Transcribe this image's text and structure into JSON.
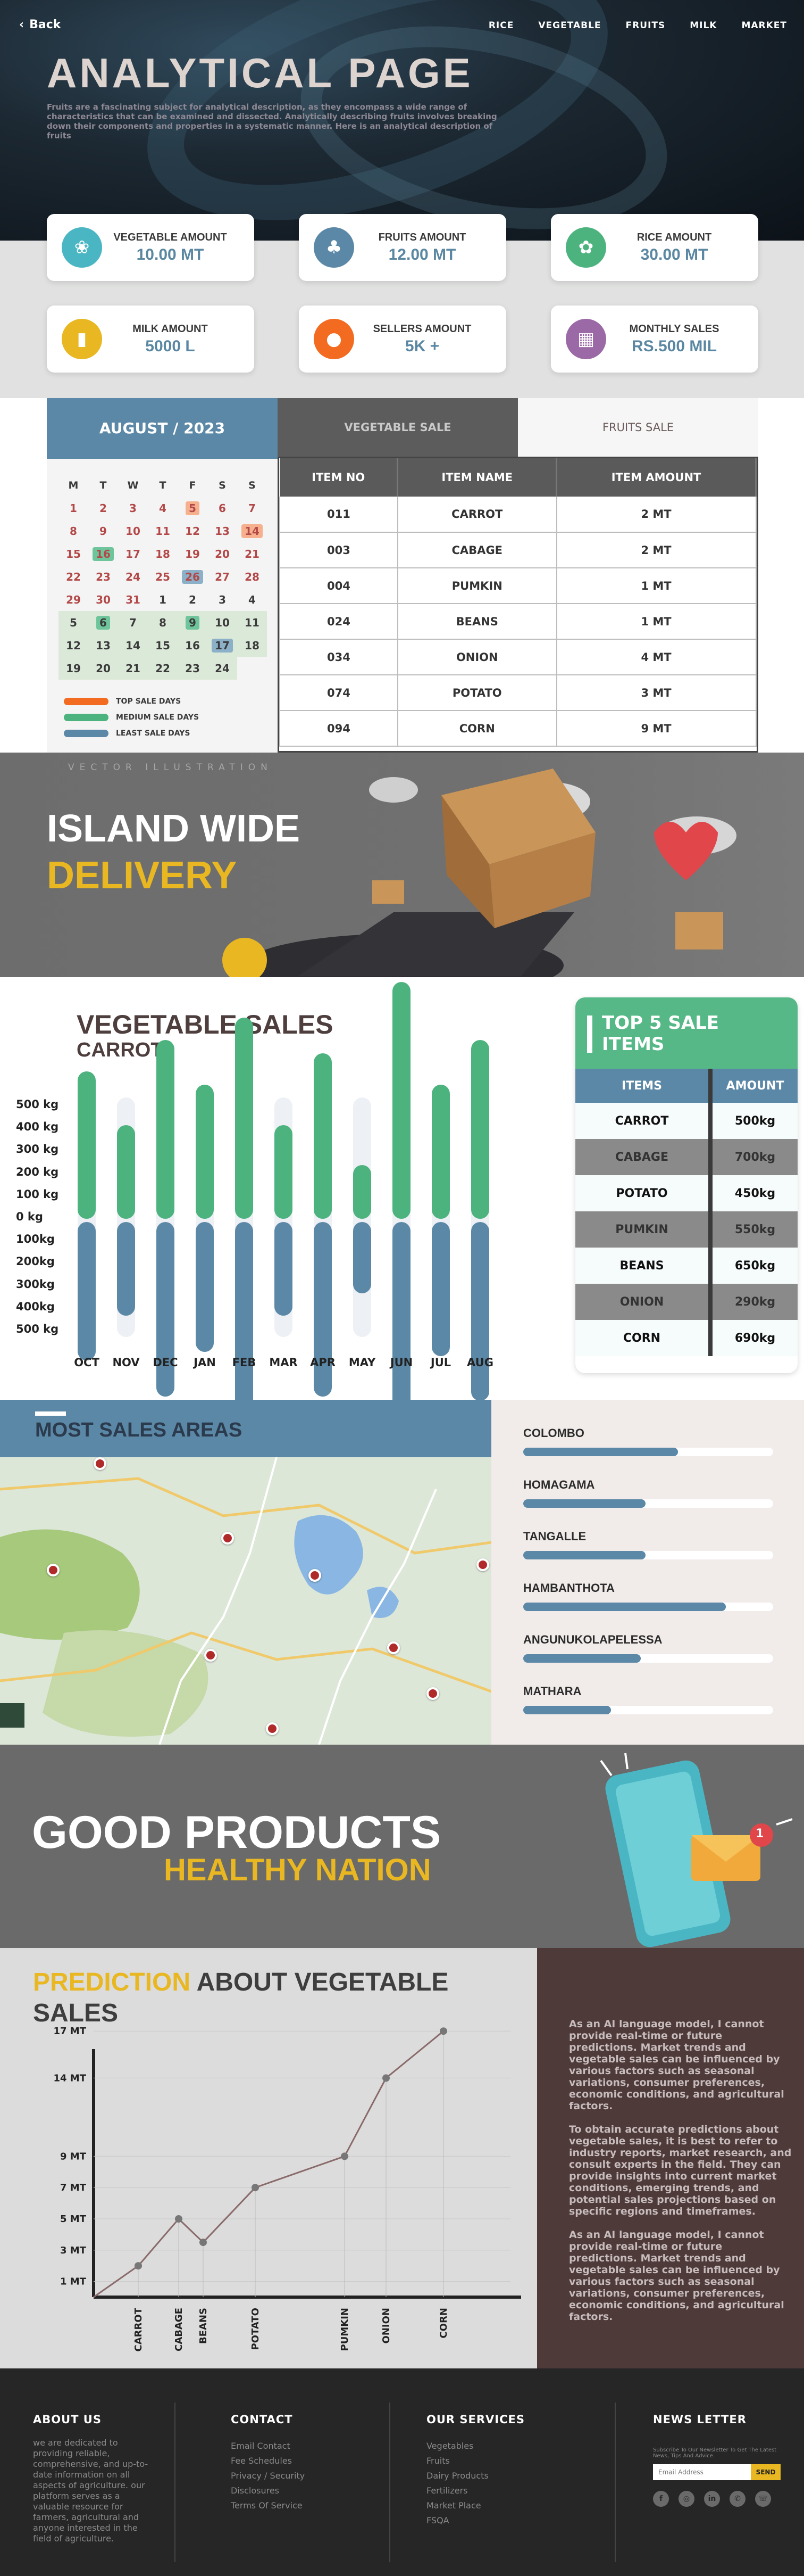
{
  "nav": {
    "back_label": "Back",
    "links": [
      "RICE",
      "VEGETABLE",
      "FRUITS",
      "MILK",
      "MARKET"
    ]
  },
  "hero": {
    "title": "ANALYTICAL PAGE",
    "description": "Fruits are a fascinating subject for analytical description, as they encompass a wide range of characteristics that can be examined and dissected. Analytically describing fruits involves breaking down their components and properties in a systematic manner. Here is an analytical description of fruits"
  },
  "stats": [
    {
      "label": "VEGETABLE AMOUNT",
      "value": "10.00 MT",
      "icon": "vegetable-icon",
      "color": "#4ab6c4"
    },
    {
      "label": "FRUITS AMOUNT",
      "value": "12.00 MT",
      "icon": "fruit-icon",
      "color": "#5b88a6"
    },
    {
      "label": "RICE AMOUNT",
      "value": "30.00 MT",
      "icon": "rice-icon",
      "color": "#4cb37e"
    },
    {
      "label": "MILK AMOUNT",
      "value": "5000 L",
      "icon": "milk-icon",
      "color": "#e8b721"
    },
    {
      "label": "SELLERS AMOUNT",
      "value": "5K +",
      "icon": "sellers-icon",
      "color": "#f26b21"
    },
    {
      "label": "MONTHLY SALES",
      "value": "RS.500 MIL",
      "icon": "calendar-icon",
      "color": "#9b6aa6"
    }
  ],
  "calendar": {
    "title": "AUGUST / 2023",
    "weekdays": [
      "M",
      "T",
      "W",
      "T",
      "F",
      "S",
      "S"
    ],
    "days": [
      "1",
      "2",
      "3",
      "4",
      "5",
      "6",
      "7",
      "8",
      "9",
      "10",
      "11",
      "12",
      "13",
      "14",
      "15",
      "16",
      "17",
      "18",
      "19",
      "20",
      "21",
      "22",
      "23",
      "24",
      "25",
      "26",
      "27",
      "28",
      "29",
      "30",
      "31",
      "1",
      "2",
      "3",
      "4",
      "5",
      "6",
      "7",
      "8",
      "9",
      "10",
      "11",
      "12",
      "13",
      "14",
      "15",
      "16",
      "17",
      "18",
      "19",
      "20",
      "21",
      "22",
      "23",
      "24"
    ],
    "legend": [
      {
        "label": "TOP SALE DAYS",
        "color": "#f26b21"
      },
      {
        "label": "MEDIUM SALE DAYS",
        "color": "#4cb37e"
      },
      {
        "label": "LEAST SALE DAYS",
        "color": "#5b88a6"
      }
    ]
  },
  "tabs": {
    "vegetable": "VEGETABLE SALE",
    "fruits": "FRUITS SALE"
  },
  "sales_table": {
    "headers": [
      "ITEM NO",
      "ITEM NAME",
      "ITEM AMOUNT"
    ],
    "rows": [
      [
        "011",
        "CARROT",
        "2 MT"
      ],
      [
        "003",
        "CABAGE",
        "2 MT"
      ],
      [
        "004",
        "PUMKIN",
        "1 MT"
      ],
      [
        "024",
        "BEANS",
        "1 MT"
      ],
      [
        "034",
        "ONION",
        "4 MT"
      ],
      [
        "074",
        "POTATO",
        "3 MT"
      ],
      [
        "094",
        "CORN",
        "9 MT"
      ]
    ]
  },
  "delivery": {
    "tag": "VECTOR ILLUSTRATION",
    "line1": "ISLAND WIDE",
    "line2": "DELIVERY"
  },
  "vegsales": {
    "title": "VEGETABLE SALES",
    "subtitle": "CARROT",
    "ylabels": [
      "500 kg",
      "400 kg",
      "300 kg",
      "200 kg",
      "100 kg",
      "0 kg",
      "100kg",
      "200kg",
      "300kg",
      "400kg",
      "500 kg"
    ]
  },
  "chart_data": [
    {
      "type": "bar",
      "title": "VEGETABLE SALES",
      "subtitle": "CARROT",
      "categories": [
        "OCT",
        "NOV",
        "DEC",
        "JAN",
        "FEB",
        "MAR",
        "APR",
        "MAY",
        "JUN",
        "JUL",
        "AUG"
      ],
      "series": [
        {
          "values": [
            330,
            210,
            400,
            300,
            450,
            210,
            370,
            120,
            530,
            300,
            400
          ],
          "color": "#4cb37e"
        },
        {
          "values": [
            -310,
            -210,
            -390,
            -290,
            -440,
            -210,
            -390,
            -160,
            -530,
            -300,
            -400
          ],
          "color": "#5b88a6"
        }
      ],
      "ylim": [
        -500,
        500
      ],
      "ylabel": "",
      "xlabel": ""
    },
    {
      "type": "line",
      "title": "PREDICTION ABOUT VEGETABLE SALES",
      "categories": [
        "CARROT",
        "CABAGE",
        "BEANS",
        "POTATO",
        "PUMKIN",
        "ONION",
        "CORN"
      ],
      "values": [
        2,
        5,
        3.5,
        7,
        9,
        14,
        17
      ],
      "yticks": [
        "1 MT",
        "3 MT",
        "5 MT",
        "7 MT",
        "9 MT",
        "14 MT",
        "17 MT"
      ]
    }
  ],
  "top5": {
    "title": "TOP 5 SALE ITEMS",
    "headers": [
      "ITEMS",
      "AMOUNT"
    ],
    "rows": [
      [
        "CARROT",
        "500kg"
      ],
      [
        "CABAGE",
        "700kg"
      ],
      [
        "POTATO",
        "450kg"
      ],
      [
        "PUMKIN",
        "550kg"
      ],
      [
        "BEANS",
        "650kg"
      ],
      [
        "ONION",
        "290kg"
      ],
      [
        "CORN",
        "690kg"
      ]
    ]
  },
  "areas": {
    "title": "MOST SALES AREAS",
    "items": [
      {
        "name": "COLOMBO",
        "level": 0.62
      },
      {
        "name": "HOMAGAMA",
        "level": 0.49
      },
      {
        "name": "TANGALLE",
        "level": 0.49
      },
      {
        "name": "HAMBANTHOTA",
        "level": 0.81
      },
      {
        "name": "ANGUNUKOLAPELESSA",
        "level": 0.47
      },
      {
        "name": "MATHARA",
        "level": 0.35
      }
    ]
  },
  "good": {
    "line1": "GOOD PRODUCTS",
    "line2": "HEALTHY NATION",
    "badge": "1"
  },
  "prediction": {
    "title_accent": "PREDICTION",
    "title_rest": "ABOUT VEGETABLE SALES",
    "text1": "As an AI language model, I cannot provide real-time or future predictions. Market trends and vegetable sales can be influenced by various factors such as seasonal variations, consumer preferences, economic conditions, and agricultural factors.",
    "text2": "To obtain accurate predictions about vegetable sales, it is best to refer to industry reports, market research, and consult experts in the field. They can provide insights into current market conditions, emerging trends, and potential sales projections based on specific regions and timeframes.",
    "text3": "As an AI language model, I cannot provide real-time or future predictions. Market trends and vegetable sales can be influenced by various factors such as seasonal variations, consumer preferences, economic conditions, and agricultural factors."
  },
  "footer": {
    "about_title": "ABOUT US",
    "about_text": "we are dedicated to providing reliable, comprehensive, and up-to-date information on all aspects of agriculture. our platform serves as a valuable resource for farmers, agricultural and anyone interested in the field of agriculture.",
    "contact_title": "CONTACT",
    "contact_links": [
      "Email Contact",
      "Fee Schedules",
      "Privacy / Security",
      "Disclosures",
      "Terms Of Service"
    ],
    "services_title": "OUR SERVICES",
    "services_links": [
      "Vegetables",
      "Fruits",
      "Dairy Products",
      "Fertilizers",
      "Market Place",
      "FSQA"
    ],
    "news_title": "NEWS LETTER",
    "news_text": "Subscribe To Our Newsletter To Get The Latest News, Tips And Advice.",
    "email_placeholder": "Email Address",
    "send_label": "SEND",
    "socials": [
      "facebook-icon",
      "instagram-icon",
      "linkedin-icon",
      "whatsapp-icon",
      "phone-icon"
    ]
  }
}
